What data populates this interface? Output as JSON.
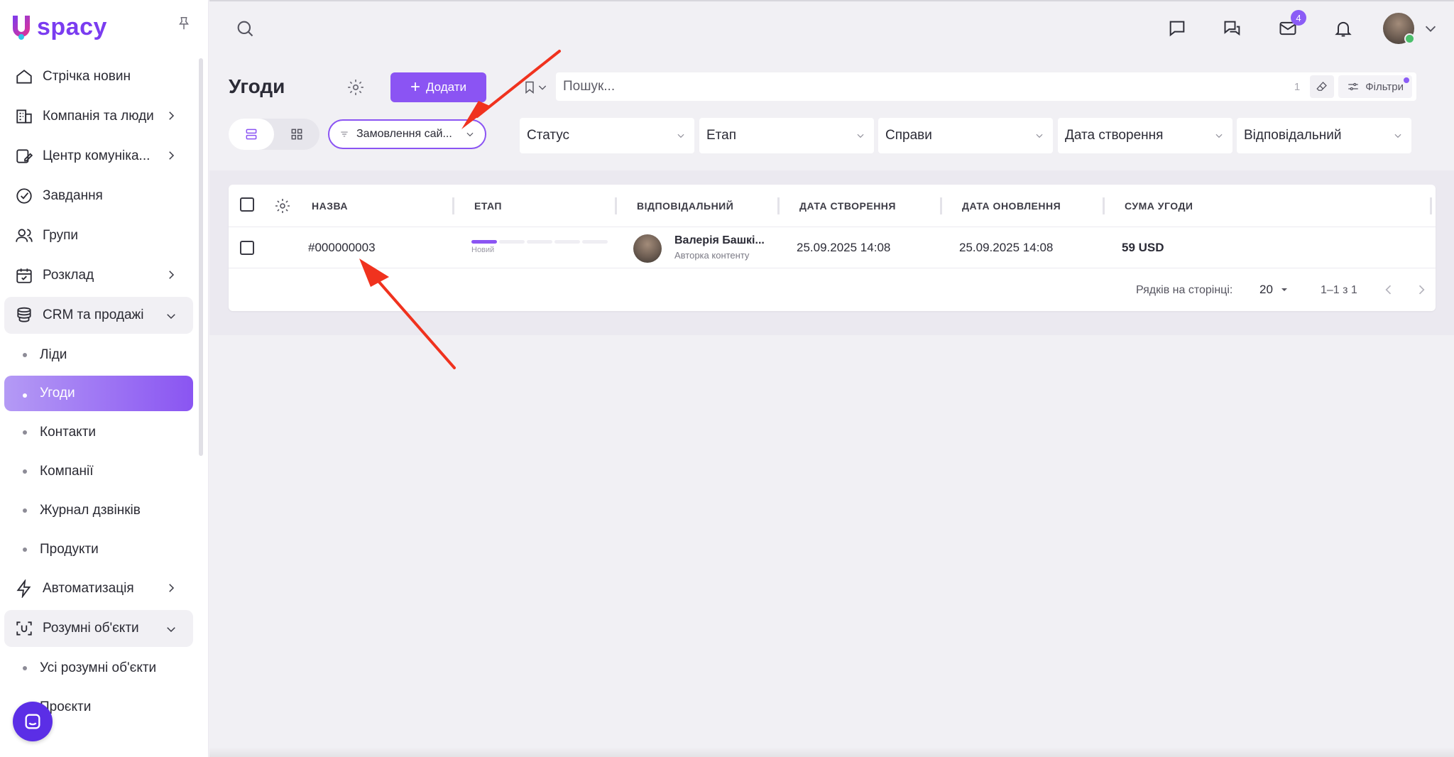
{
  "app": {
    "logo_text": "spacy"
  },
  "sidebar": {
    "items": [
      {
        "label": "Стрічка новин"
      },
      {
        "label": "Компанія та люди"
      },
      {
        "label": "Центр комуніка..."
      },
      {
        "label": "Завдання"
      },
      {
        "label": "Групи"
      },
      {
        "label": "Розклад"
      },
      {
        "label": "CRM та продажі"
      },
      {
        "label": "Ліди"
      },
      {
        "label": "Угоди"
      },
      {
        "label": "Контакти"
      },
      {
        "label": "Компанії"
      },
      {
        "label": "Журнал дзвінків"
      },
      {
        "label": "Продукти"
      },
      {
        "label": "Автоматизація"
      },
      {
        "label": "Розумні об'єкти"
      },
      {
        "label": "Усі розумні об'єкти"
      },
      {
        "label": "Проєкти"
      }
    ]
  },
  "topbar": {
    "mail_badge": "4"
  },
  "header": {
    "title": "Угоди",
    "add_label": "Додати",
    "search_placeholder": "Пошук...",
    "search_count": "1",
    "filters_label": "Фільтри",
    "preset_label": "Замовлення сай..."
  },
  "filters": [
    {
      "label": "Статус"
    },
    {
      "label": "Етап"
    },
    {
      "label": "Справи"
    },
    {
      "label": "Дата створення"
    },
    {
      "label": "Відповідальний"
    }
  ],
  "table": {
    "columns": [
      "НАЗВА",
      "ЕТАП",
      "ВІДПОВІДАЛЬНИЙ",
      "ДАТА СТВОРЕННЯ",
      "ДАТА ОНОВЛЕННЯ",
      "СУМА УГОДИ"
    ],
    "rows": [
      {
        "name": "#000000003",
        "stage": "Новий",
        "stage_progress": 0.2,
        "responsible_name": "Валерія Башкі...",
        "responsible_role": "Авторка контенту",
        "created": "25.09.2025 14:08",
        "updated": "25.09.2025 14:08",
        "amount": "59 USD"
      }
    ]
  },
  "pager": {
    "rows_label": "Рядків на сторінці:",
    "page_size": "20",
    "range": "1–1 з 1"
  },
  "colors": {
    "accent": "#8b54f3",
    "annotation_arrow": "#f0321e"
  }
}
